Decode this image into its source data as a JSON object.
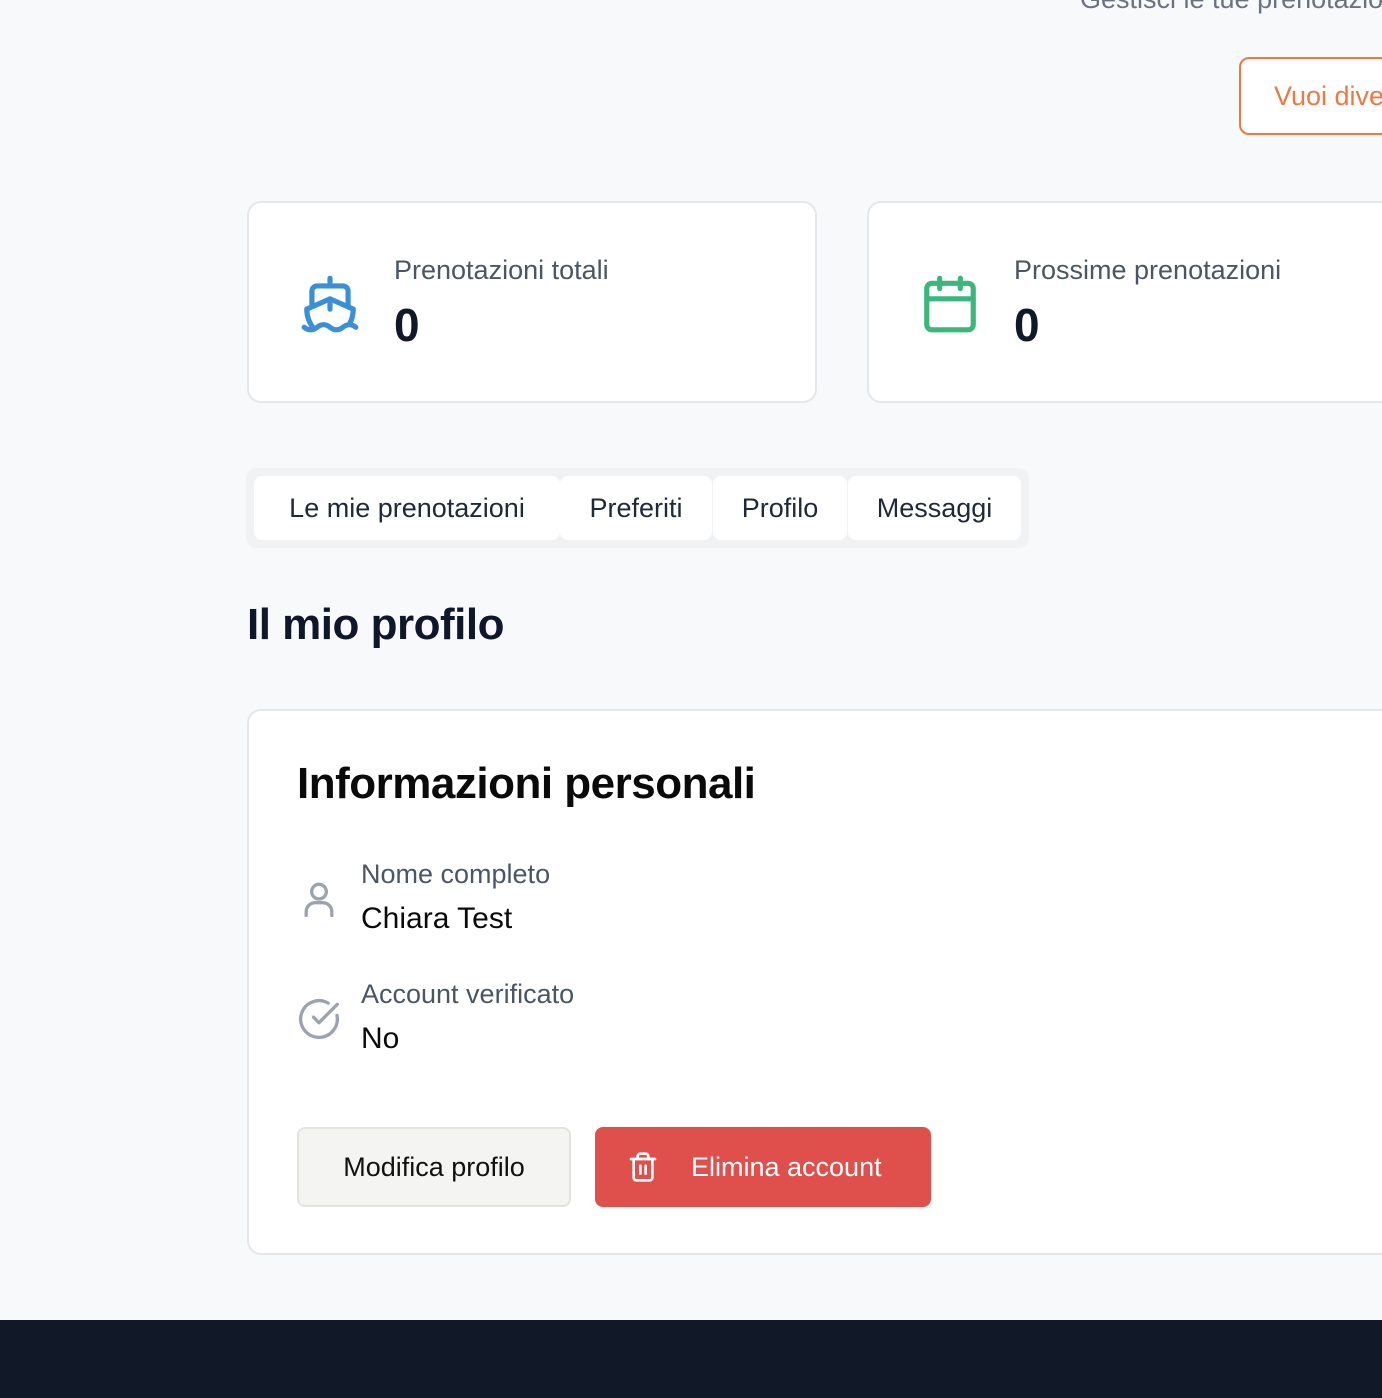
{
  "header": {
    "subtitle": "Gestisci le tue prenotazioni",
    "owner_button_label": "Vuoi diventare"
  },
  "stats": [
    {
      "label": "Prenotazioni totali",
      "value": "0",
      "icon": "ship-icon",
      "color": "#3b8fd6"
    },
    {
      "label": "Prossime prenotazioni",
      "value": "0",
      "icon": "calendar-icon",
      "color": "#3cb77c"
    }
  ],
  "tabs": [
    {
      "label": "Le mie prenotazioni"
    },
    {
      "label": "Preferiti"
    },
    {
      "label": "Profilo",
      "active": true
    },
    {
      "label": "Messaggi"
    }
  ],
  "profile": {
    "section_title": "Il mio profilo",
    "card_title": "Informazioni personali",
    "fields": [
      {
        "label": "Nome completo",
        "value": "Chiara Test",
        "icon": "user-icon"
      },
      {
        "label": "Account verificato",
        "value": "No",
        "icon": "check-circle-icon"
      }
    ],
    "edit_button": "Modifica profilo",
    "delete_button": "Elimina account"
  },
  "colors": {
    "accent_orange": "#ea7a43",
    "danger": "#df4f4b",
    "footer": "#111827"
  }
}
